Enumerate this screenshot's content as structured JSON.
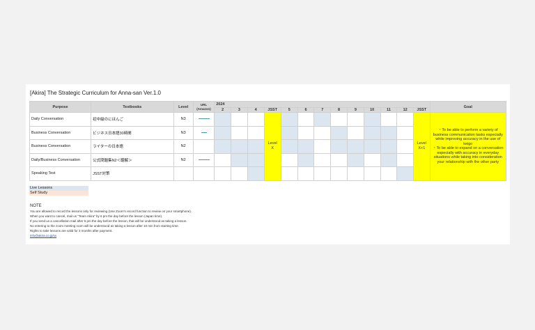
{
  "title": "[Akira] The Strategic Curriculum for Anna-san Ver.1.0",
  "headers": {
    "purpose": "Purpose",
    "textbooks": "Textbooks",
    "level": "Level",
    "url": "URL\n(Amazon)",
    "year": "2024",
    "months": [
      "2",
      "3",
      "4",
      "JSST",
      "5",
      "6",
      "7",
      "8",
      "9",
      "10",
      "11",
      "12",
      "JSST"
    ],
    "goal": "Goal"
  },
  "rows": [
    {
      "purpose": "Daily Conversation",
      "textbook": "初中級のにほんご",
      "level": "N3"
    },
    {
      "purpose": "Business Conversation",
      "textbook": "ビジネス日本語30時間",
      "level": "N3"
    },
    {
      "purpose": "Business Conversation",
      "textbook": "ライターの日本語",
      "level": "N2"
    },
    {
      "purpose": "Daily/Business Conversation",
      "textbook": "公式問題集N2＜聴解＞",
      "level": "N2"
    },
    {
      "purpose": "Speaking Test",
      "textbook": "JSST対策",
      "level": ""
    }
  ],
  "jsst_labels": {
    "first": "Level\nX",
    "second": "Level\nX+1"
  },
  "goal_text": "・To be able to perform a variety of business communication tasks especially while improving accuracy in the use of keigo\n・To be able to expand on a conversation especially with accuracy in everyday situations while taking into consideration your relationship with the other party",
  "legend": {
    "live": "Live Lessons",
    "self": "Self Study"
  },
  "notes": {
    "heading": "NOTE",
    "lines": [
      "You are allowed to record the lessons only for reviewing (Use Zoom's record function to review on your smartphone).",
      "When you want to cancel, mail us \"Team Akira\" by 6 pm the day before the lesson (Japan time).",
      "If you send us a cancellation mail after 6 pm the day before the lesson, that will be understood as taking a lesson.",
      "No entering to the zoom meeting room will be understood as taking a lesson after 10 min from starting time.",
      "Rights to take lessons are valid for 3 months after payment."
    ],
    "email": "info@akira.co.jp/ss"
  },
  "colors": {
    "live": "#dce6f1",
    "self": "#fce4d6",
    "jsst": "#ffff00",
    "url_line": "#4a9a9a"
  }
}
